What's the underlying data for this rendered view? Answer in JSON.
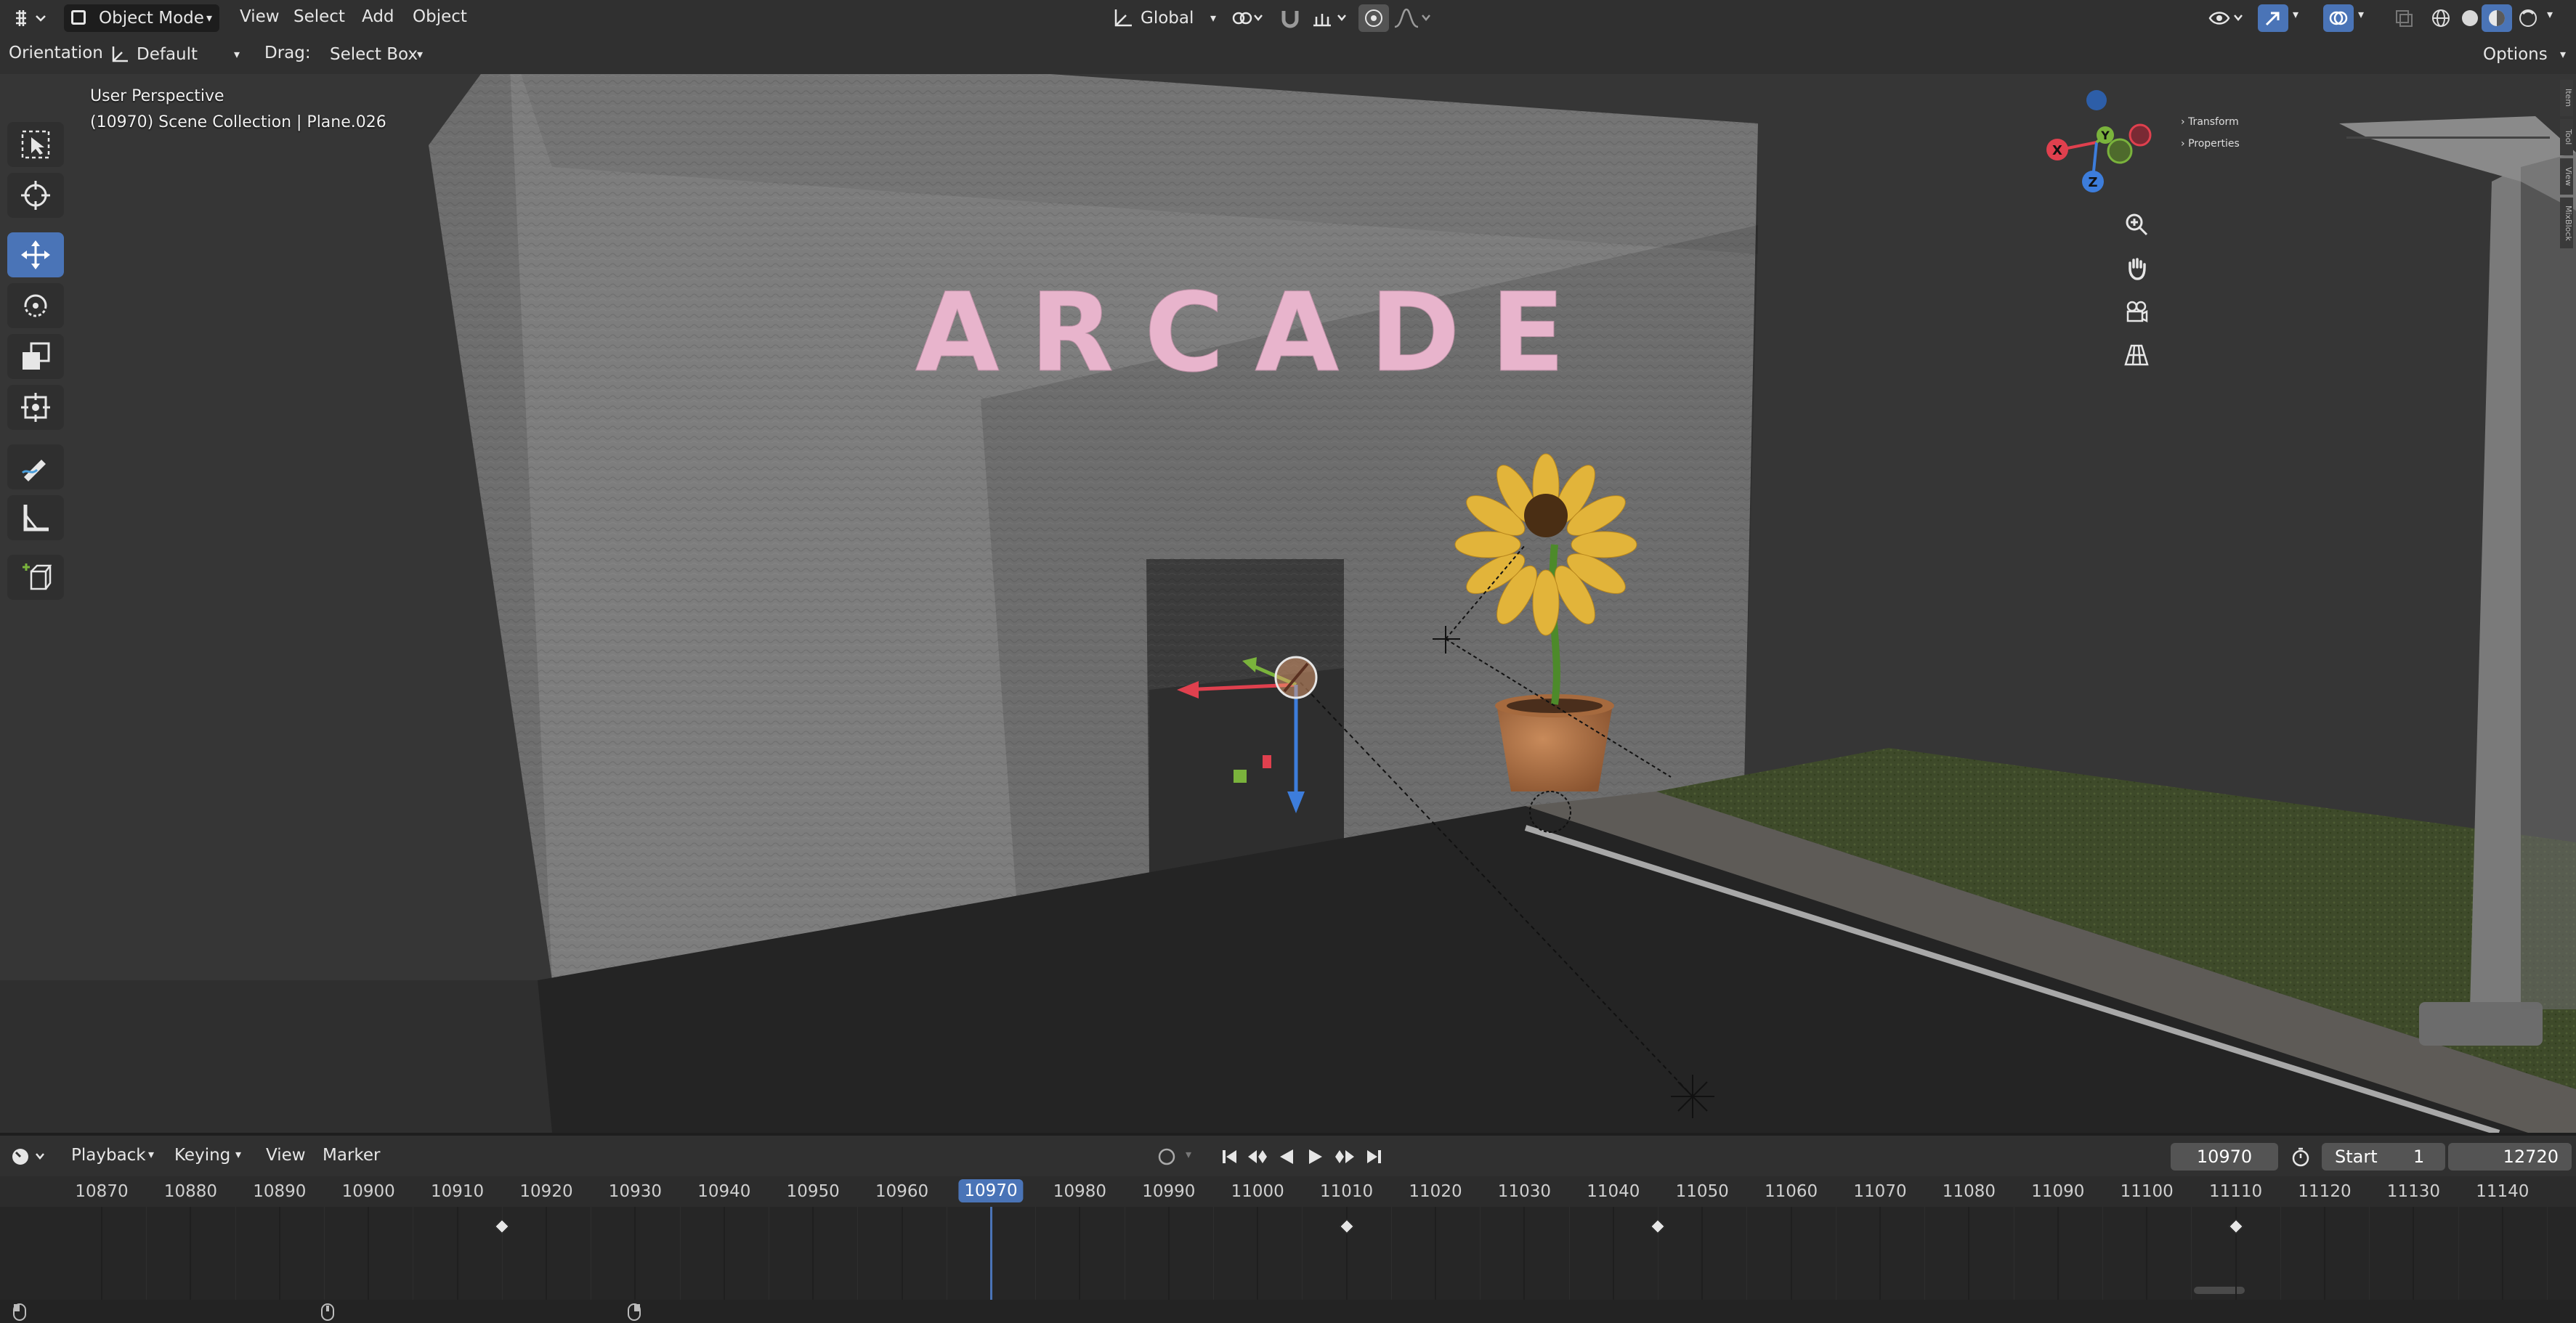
{
  "header": {
    "mode": "Object Mode",
    "menus": [
      "View",
      "Select",
      "Add",
      "Object"
    ],
    "transform_orientation": "Global"
  },
  "tool_header": {
    "orientation_label": "Orientation:",
    "orientation_value": "Default",
    "drag_label": "Drag:",
    "drag_value": "Select Box",
    "options_label": "Options"
  },
  "viewport": {
    "perspective": "User Perspective",
    "collection_info": "(10970) Scene Collection | Plane.026",
    "sign_text": "ARCADE",
    "gizmo_axes": {
      "x": "X",
      "y": "Y",
      "z": "Z"
    },
    "colors": {
      "x_axis": "#e0404e",
      "y_axis": "#7ab33c",
      "z_axis": "#3d7ddb",
      "sign": "#e8b4cc",
      "active_tool": "#4a74b7"
    }
  },
  "n_panel": {
    "items": [
      "Transform",
      "Properties"
    ],
    "tabs": [
      "Item",
      "Tool",
      "View",
      "MixBlock"
    ]
  },
  "timeline": {
    "menus": [
      "Playback",
      "Keying",
      "View",
      "Marker"
    ],
    "current_frame": "10970",
    "start_label": "Start",
    "start_value": "1",
    "end_value": "12720",
    "frames": [
      "10870",
      "10880",
      "10890",
      "10900",
      "10910",
      "10920",
      "10930",
      "10940",
      "10950",
      "10960",
      "10970",
      "10980",
      "10990",
      "11000",
      "11010",
      "11020",
      "11030",
      "11040",
      "11050",
      "11060",
      "11070",
      "11080",
      "11090",
      "11100",
      "11110",
      "11120",
      "11130",
      "11140"
    ],
    "keyframes": [
      "10915",
      "11010",
      "11045",
      "11110"
    ]
  }
}
